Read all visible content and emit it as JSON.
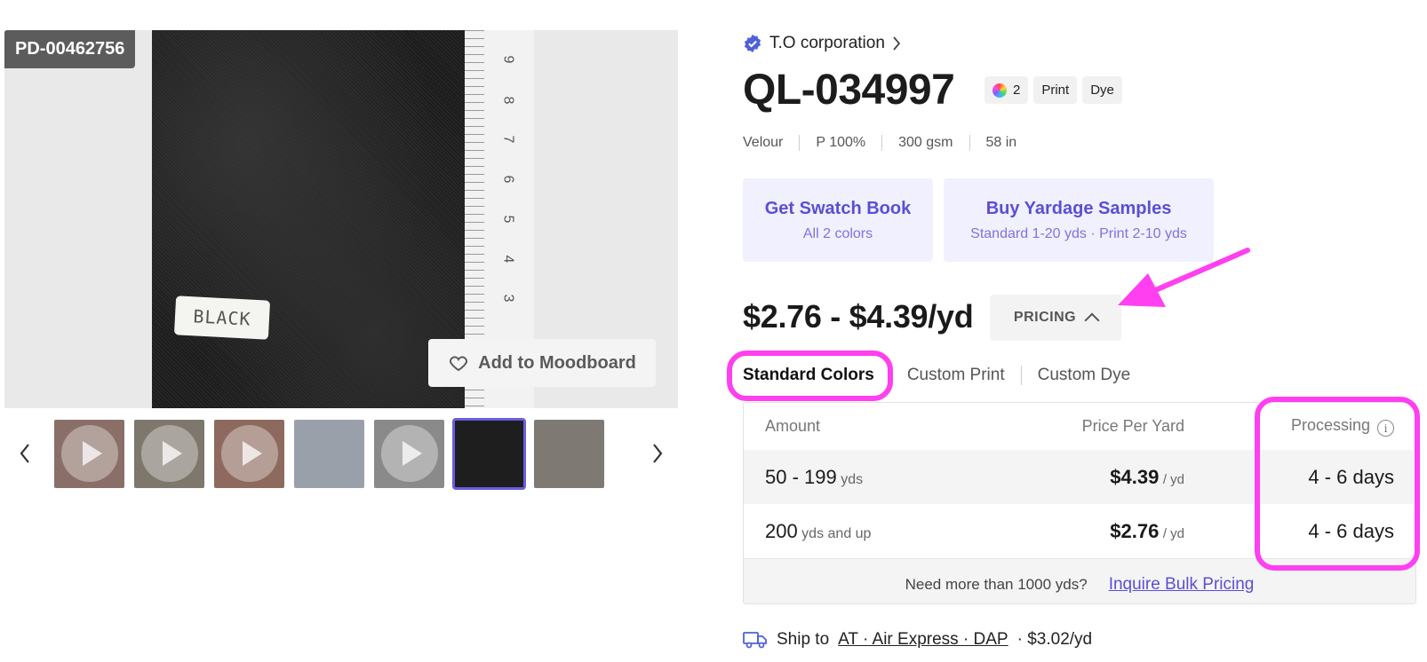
{
  "gallery": {
    "product_code": "PD-00462756",
    "swatch_label": "BLACK",
    "ruler_numbers": [
      "9",
      "8",
      "7",
      "6",
      "5",
      "4",
      "3"
    ],
    "moodboard_label": "Add to Moodboard",
    "thumbnails": [
      {
        "kind": "video",
        "color": "#8a6f68"
      },
      {
        "kind": "video",
        "color": "#7d776c"
      },
      {
        "kind": "video",
        "color": "#8e6a5e"
      },
      {
        "kind": "image",
        "color": "#9aa0aa"
      },
      {
        "kind": "video",
        "color": "#8a8a8a"
      },
      {
        "kind": "image-selected",
        "color": "#1e1e1e"
      },
      {
        "kind": "image",
        "color": "#7e7a73"
      }
    ]
  },
  "product": {
    "brand": "T.O corporation",
    "code": "QL-034997",
    "color_count": "2",
    "tags": [
      "Print",
      "Dye"
    ],
    "specs": [
      "Velour",
      "P 100%",
      "300 gsm",
      "58 in"
    ]
  },
  "cta": {
    "swatch_title": "Get Swatch Book",
    "swatch_sub": "All 2 colors",
    "samples_title": "Buy Yardage Samples",
    "samples_sub": "Standard 1-20 yds · Print 2-10 yds"
  },
  "pricing": {
    "range": "$2.76 - $4.39/yd",
    "toggle_label": "PRICING",
    "tabs": [
      "Standard Colors",
      "Custom Print",
      "Custom Dye"
    ],
    "columns": {
      "amount": "Amount",
      "price": "Price Per Yard",
      "processing": "Processing"
    },
    "rows": [
      {
        "amount": "50 - 199",
        "amount_unit": "yds",
        "price": "$4.39",
        "price_unit": "/ yd",
        "processing": "4 - 6 days"
      },
      {
        "amount": "200",
        "amount_unit": "yds and up",
        "price": "$2.76",
        "price_unit": "/ yd",
        "processing": "4 - 6 days"
      }
    ],
    "bulk_text": "Need more than 1000 yds?",
    "bulk_link": "Inquire Bulk Pricing"
  },
  "shipping": {
    "prefix": "Ship to",
    "method": "AT · Air Express · DAP",
    "cost": "· $3.02/yd"
  },
  "colors": {
    "accent": "#5a4fd4",
    "cta_bg": "#f1f0fe",
    "annotation": "#ff3ff0"
  }
}
